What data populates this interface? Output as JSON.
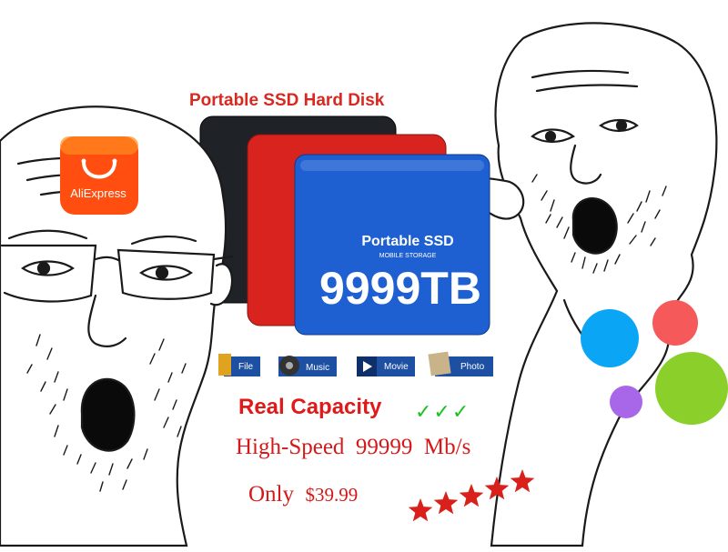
{
  "product": {
    "heading": "Portable SSD Hard Disk",
    "ssd_label": "Portable SSD",
    "ssd_sublabel": "MOBILE STORAGE",
    "capacity": "9999TB",
    "colors": {
      "black": "#1f2328",
      "red": "#d8231f",
      "blue": "#1e60d2"
    }
  },
  "media_tiles": [
    {
      "label": "File"
    },
    {
      "label": "Music"
    },
    {
      "label": "Movie"
    },
    {
      "label": "Photo"
    }
  ],
  "claims": {
    "real_capacity": "Real Capacity",
    "checkmarks": "✓✓✓",
    "speed_prefix": "High-Speed",
    "speed_value": "99999",
    "speed_unit": "Mb/s",
    "only": "Only",
    "price": "$39.99",
    "rating": 5
  },
  "brand": {
    "name": "AliExpress",
    "color": "#ff4e0f"
  },
  "dots": [
    "#0aa6f5",
    "#f5595a",
    "#8bcf2b",
    "#a767e8"
  ]
}
